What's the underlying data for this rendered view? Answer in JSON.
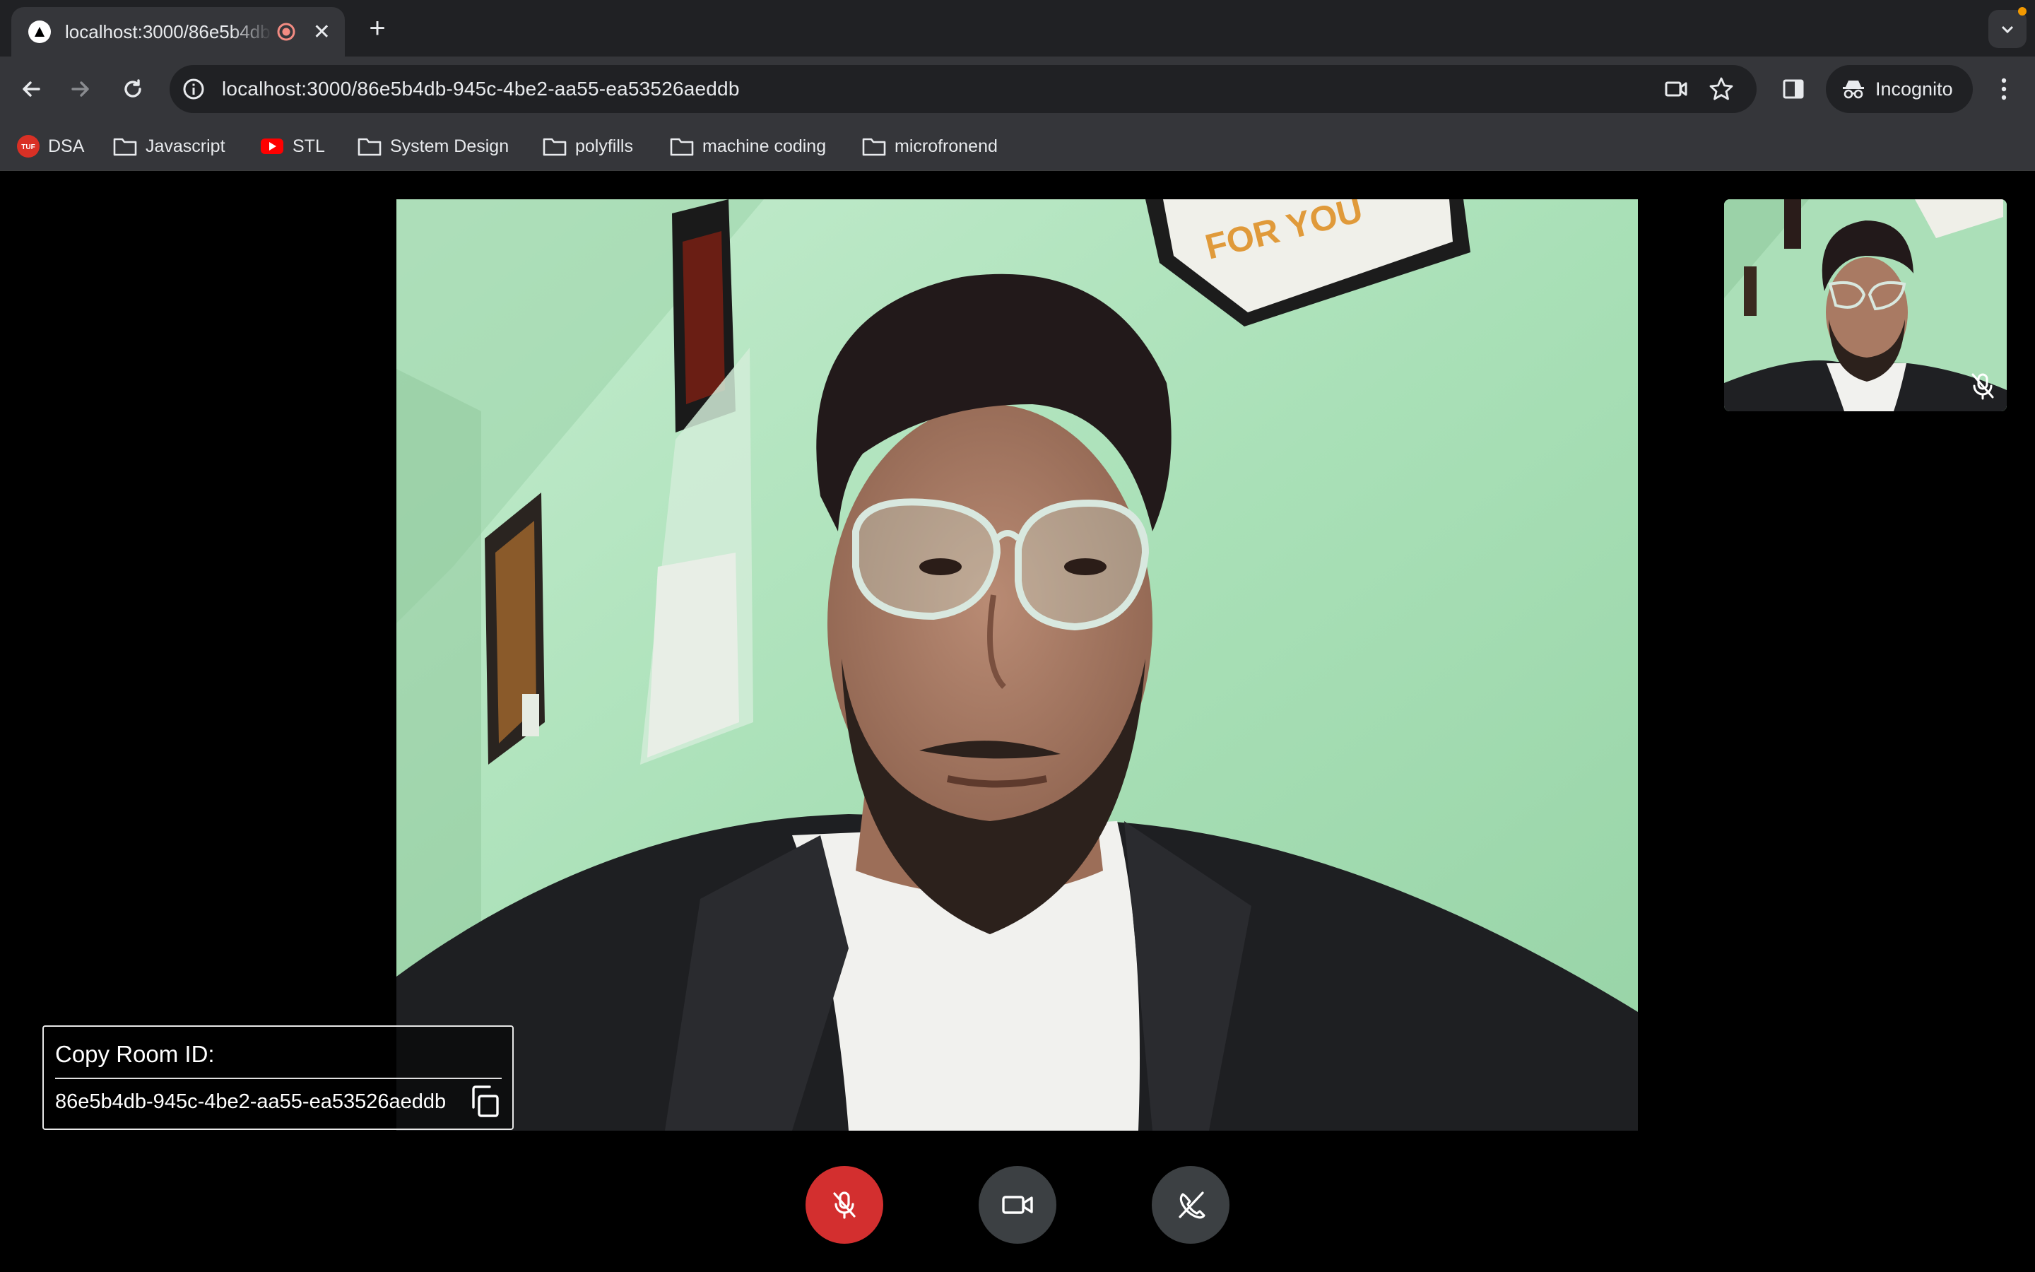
{
  "browser": {
    "tab_title": "localhost:3000/86e5b4db-945c-4be2-aa55-ea53526aeddb",
    "url": "localhost:3000/86e5b4db-945c-4be2-aa55-ea53526aeddb",
    "incognito_label": "Incognito",
    "bookmarks": [
      {
        "label": "DSA",
        "icon": "tuf-favicon"
      },
      {
        "label": "Javascript",
        "icon": "folder-icon"
      },
      {
        "label": "STL",
        "icon": "youtube-icon"
      },
      {
        "label": "System Design",
        "icon": "folder-icon"
      },
      {
        "label": "polyfills",
        "icon": "folder-icon"
      },
      {
        "label": "machine coding",
        "icon": "folder-icon"
      },
      {
        "label": "microfronend",
        "icon": "folder-icon"
      }
    ]
  },
  "room": {
    "title": "Copy Room ID:",
    "id": "86e5b4db-945c-4be2-aa55-ea53526aeddb"
  },
  "controls": {
    "mic": {
      "icon": "mic-off-icon",
      "color": "#d32f2f"
    },
    "camera": {
      "icon": "video-camera-icon",
      "color": "#3c4043"
    },
    "end_call": {
      "icon": "call-end-icon",
      "color": "#3c4043"
    }
  },
  "colors": {
    "chrome_dark": "#202124",
    "chrome_toolbar": "#35363a",
    "background": "#000000",
    "danger": "#d32f2f"
  }
}
